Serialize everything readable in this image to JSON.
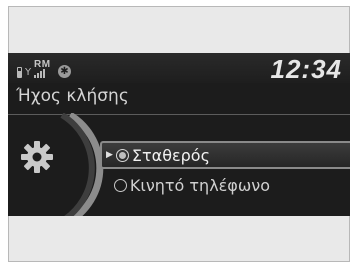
{
  "status": {
    "rm_label": "RM",
    "bluetooth_glyph": "✱",
    "clock": "12:34"
  },
  "screen": {
    "title": "Ήχος κλήσης",
    "options": [
      {
        "label": "Σταθερός",
        "selected": true
      },
      {
        "label": "Κινητό τηλέφωνο",
        "selected": false
      }
    ]
  },
  "icons": {
    "battery": "battery-icon",
    "signal": "signal-strength-icon",
    "bluetooth": "bluetooth-icon",
    "settings": "gear-icon"
  },
  "colors": {
    "screen_bg": "#1c1c1c",
    "frame_bg": "#e9e9e9",
    "highlight_border": "#8a8a8a",
    "text": "#d0d0d0"
  }
}
